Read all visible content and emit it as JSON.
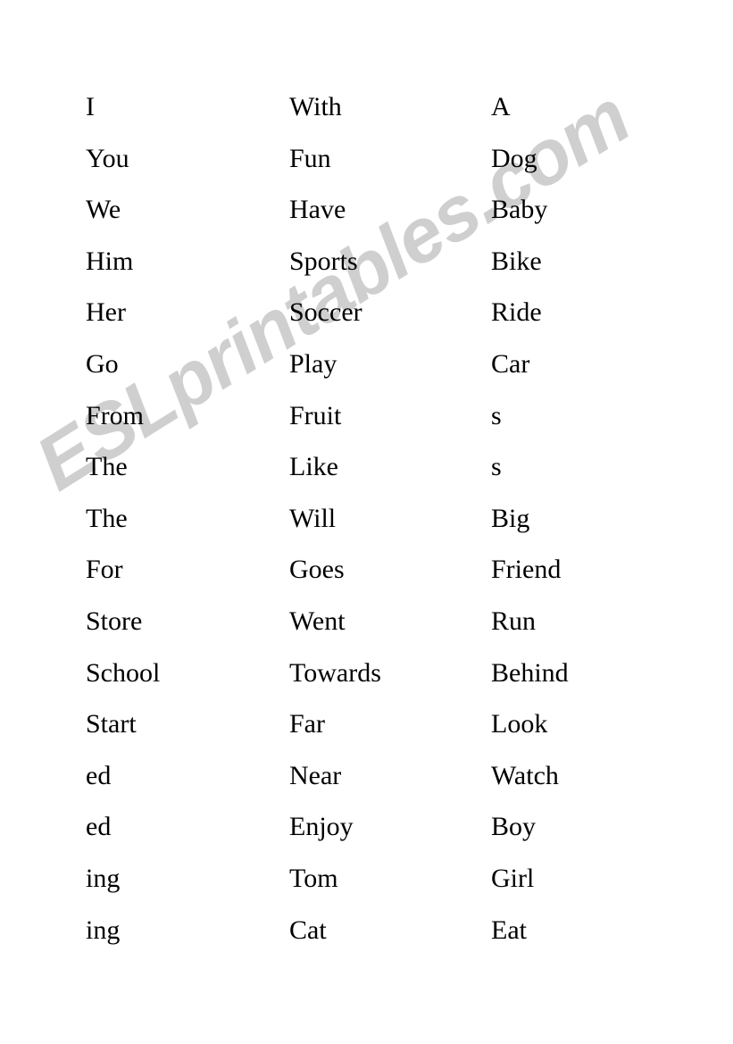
{
  "page": {
    "background_color": "#ffffff",
    "text_color": "#000000"
  },
  "watermark": {
    "text": "ESLprintables.com",
    "color": "#cfcfcf",
    "rotation_deg": -32
  },
  "worksheet": {
    "columns": [
      {
        "index": 1,
        "words": [
          "I",
          "You",
          "We",
          "Him",
          "Her",
          "Go",
          "From",
          "The",
          "The",
          "For",
          "Store",
          "School",
          "Start",
          "ed",
          "ed",
          "ing",
          "ing"
        ]
      },
      {
        "index": 2,
        "words": [
          "With",
          "Fun",
          "Have",
          "Sports",
          "Soccer",
          "Play",
          "Fruit",
          "Like",
          "Will",
          "Goes",
          "Went",
          "Towards",
          "Far",
          "Near",
          "Enjoy",
          "Tom",
          "Cat"
        ]
      },
      {
        "index": 3,
        "words": [
          "A",
          "Dog",
          "Baby",
          "Bike",
          "Ride",
          "Car",
          "s",
          "s",
          "Big",
          "Friend",
          "Run",
          "Behind",
          "Look",
          "Watch",
          "Boy",
          "Girl",
          "Eat"
        ]
      }
    ],
    "rows": [
      [
        "I",
        "With",
        "A"
      ],
      [
        "You",
        "Fun",
        "Dog"
      ],
      [
        "We",
        "Have",
        "Baby"
      ],
      [
        "Him",
        "Sports",
        "Bike"
      ],
      [
        "Her",
        "Soccer",
        "Ride"
      ],
      [
        "Go",
        "Play",
        "Car"
      ],
      [
        "From",
        "Fruit",
        "s"
      ],
      [
        "The",
        "Like",
        "s"
      ],
      [
        "The",
        "Will",
        "Big"
      ],
      [
        "For",
        "Goes",
        "Friend"
      ],
      [
        "Store",
        "Went",
        "Run"
      ],
      [
        "School",
        "Towards",
        "Behind"
      ],
      [
        "Start",
        "Far",
        "Look"
      ],
      [
        "ed",
        "Near",
        "Watch"
      ],
      [
        "ed",
        "Enjoy",
        "Boy"
      ],
      [
        "ing",
        "Tom",
        "Girl"
      ],
      [
        "ing",
        "Cat",
        "Eat"
      ]
    ]
  }
}
